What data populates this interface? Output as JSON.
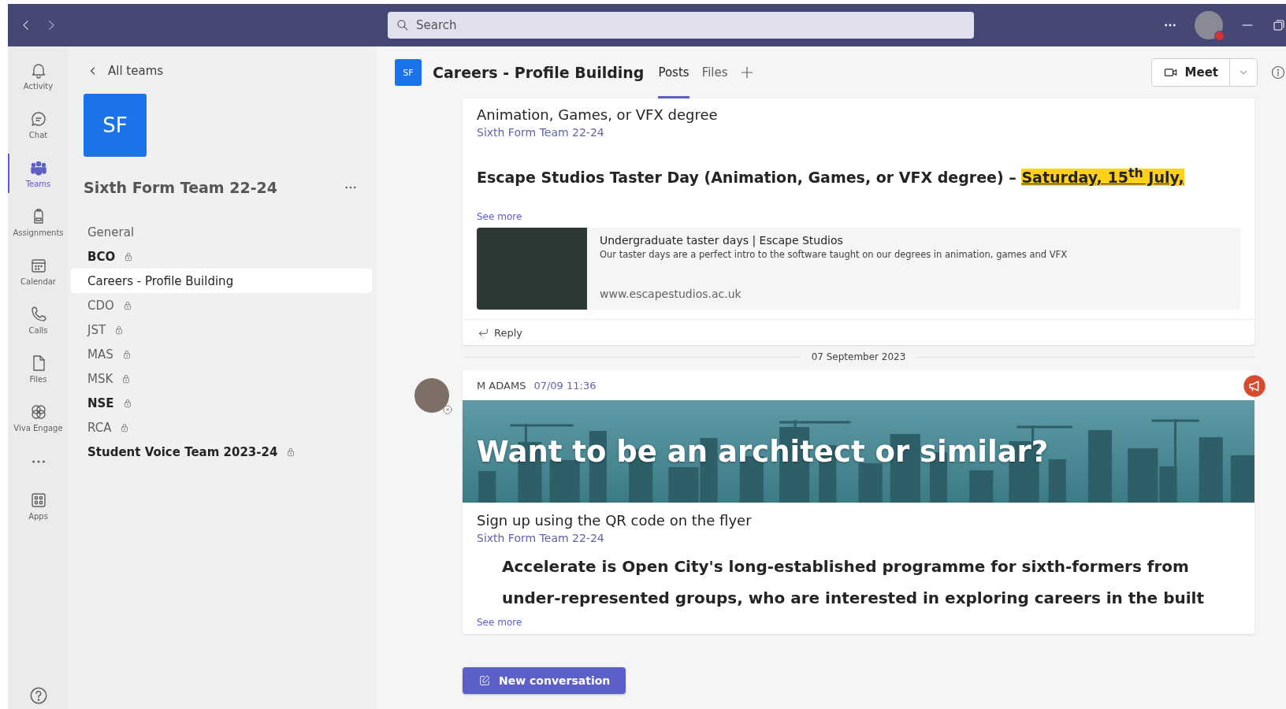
{
  "title_bar": {
    "search": {
      "placeholder": "Search"
    },
    "avatar": {
      "busy": true
    }
  },
  "rail": {
    "items": [
      {
        "label": "Activity",
        "selected": false
      },
      {
        "label": "Chat",
        "selected": false
      },
      {
        "label": "Teams",
        "selected": true
      },
      {
        "label": "Assignments",
        "selected": false
      },
      {
        "label": "Calendar",
        "selected": false
      },
      {
        "label": "Calls",
        "selected": false
      },
      {
        "label": "Files",
        "selected": false
      },
      {
        "label": "Viva Engage",
        "selected": false
      },
      {
        "label": "Apps",
        "selected": false
      }
    ]
  },
  "team_panel": {
    "back_link": "All teams",
    "team_avatar": "SF",
    "team_name": "Sixth Form Team 22-24",
    "channels": [
      {
        "name": "General",
        "unread": false,
        "private": false,
        "selected": false
      },
      {
        "name": "BCO",
        "unread": true,
        "private": true,
        "selected": false
      },
      {
        "name": "Careers - Profile Building",
        "unread": false,
        "private": false,
        "selected": true
      },
      {
        "name": "CDO",
        "unread": false,
        "private": true,
        "selected": false
      },
      {
        "name": "JST",
        "unread": false,
        "private": true,
        "selected": false
      },
      {
        "name": "MAS",
        "unread": false,
        "private": true,
        "selected": false
      },
      {
        "name": "MSK",
        "unread": false,
        "private": true,
        "selected": false
      },
      {
        "name": "NSE",
        "unread": true,
        "private": true,
        "selected": false
      },
      {
        "name": "RCA",
        "unread": false,
        "private": true,
        "selected": false
      },
      {
        "name": "Student Voice Team 2023-24",
        "unread": true,
        "private": true,
        "selected": false
      }
    ]
  },
  "channel_header": {
    "avatar": "SF",
    "title": "Careers - Profile Building",
    "tabs": [
      {
        "label": "Posts",
        "selected": true
      },
      {
        "label": "Files",
        "selected": false
      }
    ],
    "meet_button": "Meet"
  },
  "feed": {
    "posts": [
      {
        "kind": "continued",
        "body": "Animation, Games, or VFX degree",
        "team": "Sixth Form Team 22-24",
        "heading": "Escape Studios Taster Day (Animation, Games, or VFX degree) –",
        "heading_highlight": "Saturday, 15$^{th}$ July,",
        "see_more": "See more",
        "link_preview": {
          "title": "Undergraduate taster days | Escape Studios",
          "description": "Our taster days are a perfect intro to the software taught on our degrees in animation, games and VFX",
          "url": "www.escapestudios.ac.uk"
        },
        "reply": "Reply"
      },
      {
        "kind": "date_divider",
        "text": "07 September 2023"
      },
      {
        "kind": "message",
        "author": "M ADAMS",
        "time": "07/09 11:36",
        "announcement": true,
        "banner_text": "Want to be an architect or similar?",
        "body": "Sign up using the QR code on the flyer",
        "team": "Sixth Form Team 22-24",
        "quote": "Accelerate is Open City's long-established programme for sixth-formers from under-represented groups, who are interested in exploring careers in the built",
        "see_more": "See more"
      }
    ],
    "new_conversation": "New conversation"
  }
}
